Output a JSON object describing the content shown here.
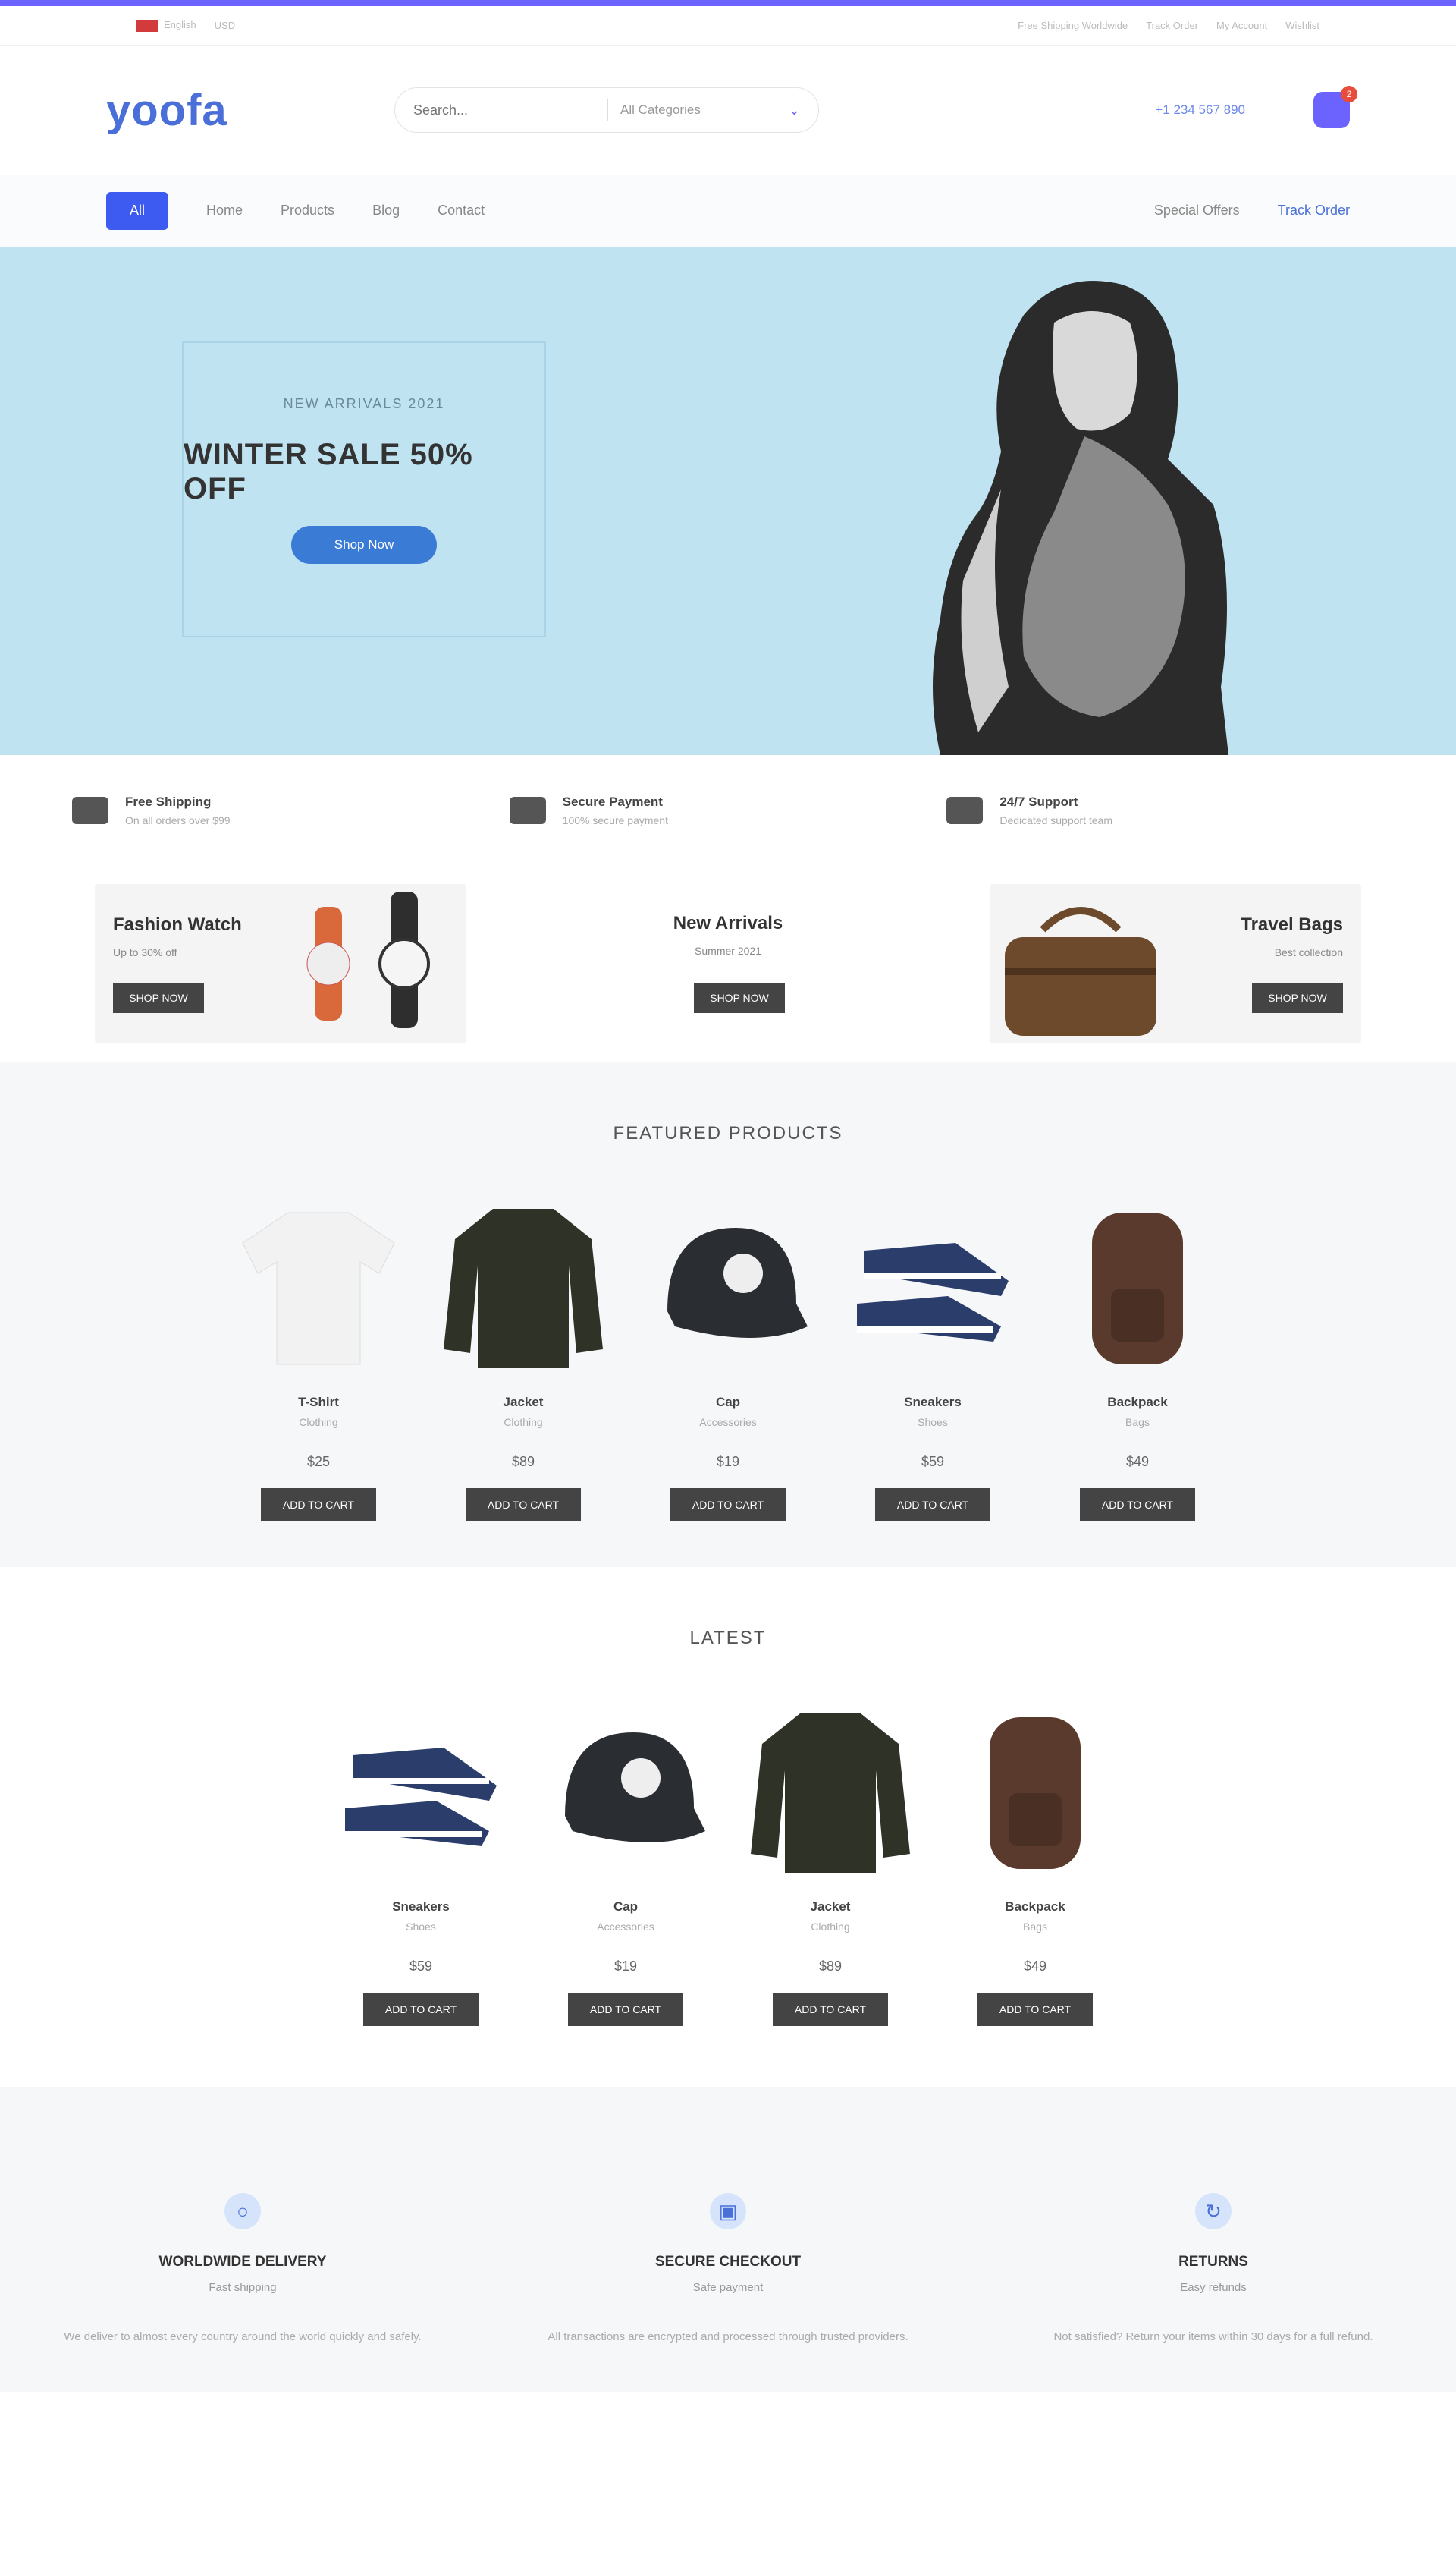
{
  "topbar": {
    "language": "English",
    "currency": "USD",
    "links": [
      "Free Shipping Worldwide",
      "Track Order",
      "My Account",
      "Wishlist"
    ]
  },
  "header": {
    "logo": "yoofa",
    "search_placeholder": "Search...",
    "category_select": "All Categories",
    "phone": "+1 234 567 890",
    "cart_count": "2"
  },
  "nav": {
    "all_label": "All",
    "items": [
      "Home",
      "Products",
      "Blog",
      "Contact"
    ],
    "right_items": [
      "Special Offers",
      "Track Order"
    ]
  },
  "hero": {
    "subtitle": "NEW ARRIVALS 2021",
    "title": "WINTER SALE 50% OFF",
    "button": "Shop Now"
  },
  "features": [
    {
      "title": "Free Shipping",
      "desc": "On all orders over $99"
    },
    {
      "title": "Secure Payment",
      "desc": "100% secure payment"
    },
    {
      "title": "24/7 Support",
      "desc": "Dedicated support team"
    }
  ],
  "banners": {
    "left": {
      "title": "Fashion Watch",
      "desc": "Up to 30% off",
      "button": "SHOP NOW"
    },
    "middle": {
      "title": "New Arrivals",
      "desc": "Summer 2021",
      "button": "SHOP NOW"
    },
    "right": {
      "title": "Travel Bags",
      "desc": "Best collection",
      "button": "SHOP NOW"
    }
  },
  "sections": {
    "featured_title": "FEATURED PRODUCTS",
    "featured": [
      {
        "name": "T-Shirt",
        "category": "Clothing",
        "price": "$25",
        "button": "ADD TO CART",
        "icon": "tshirt-white"
      },
      {
        "name": "Jacket",
        "category": "Clothing",
        "price": "$89",
        "button": "ADD TO CART",
        "icon": "jacket-dark"
      },
      {
        "name": "Cap",
        "category": "Accessories",
        "price": "$19",
        "button": "ADD TO CART",
        "icon": "cap-dark"
      },
      {
        "name": "Sneakers",
        "category": "Shoes",
        "price": "$59",
        "button": "ADD TO CART",
        "icon": "sneakers-blue"
      },
      {
        "name": "Backpack",
        "category": "Bags",
        "price": "$49",
        "button": "ADD TO CART",
        "icon": "backpack-brown"
      }
    ],
    "latest_title": "LATEST",
    "latest": [
      {
        "name": "Sneakers",
        "category": "Shoes",
        "price": "$59",
        "button": "ADD TO CART",
        "icon": "sneakers-blue"
      },
      {
        "name": "Cap",
        "category": "Accessories",
        "price": "$19",
        "button": "ADD TO CART",
        "icon": "cap-dark"
      },
      {
        "name": "Jacket",
        "category": "Clothing",
        "price": "$89",
        "button": "ADD TO CART",
        "icon": "jacket-dark"
      },
      {
        "name": "Backpack",
        "category": "Bags",
        "price": "$49",
        "button": "ADD TO CART",
        "icon": "backpack-brown"
      }
    ]
  },
  "services": [
    {
      "title": "WORLDWIDE DELIVERY",
      "desc": "Fast shipping",
      "text": "We deliver to almost every country around the world quickly and safely.",
      "icon": "globe-icon"
    },
    {
      "title": "SECURE CHECKOUT",
      "desc": "Safe payment",
      "text": "All transactions are encrypted and processed through trusted providers.",
      "icon": "card-icon"
    },
    {
      "title": "RETURNS",
      "desc": "Easy refunds",
      "text": "Not satisfied? Return your items within 30 days for a full refund.",
      "icon": "refresh-icon"
    }
  ],
  "colors": {
    "accent": "#6c63ff",
    "primary": "#3d5af1",
    "hero_bg": "#bfe3f1"
  }
}
